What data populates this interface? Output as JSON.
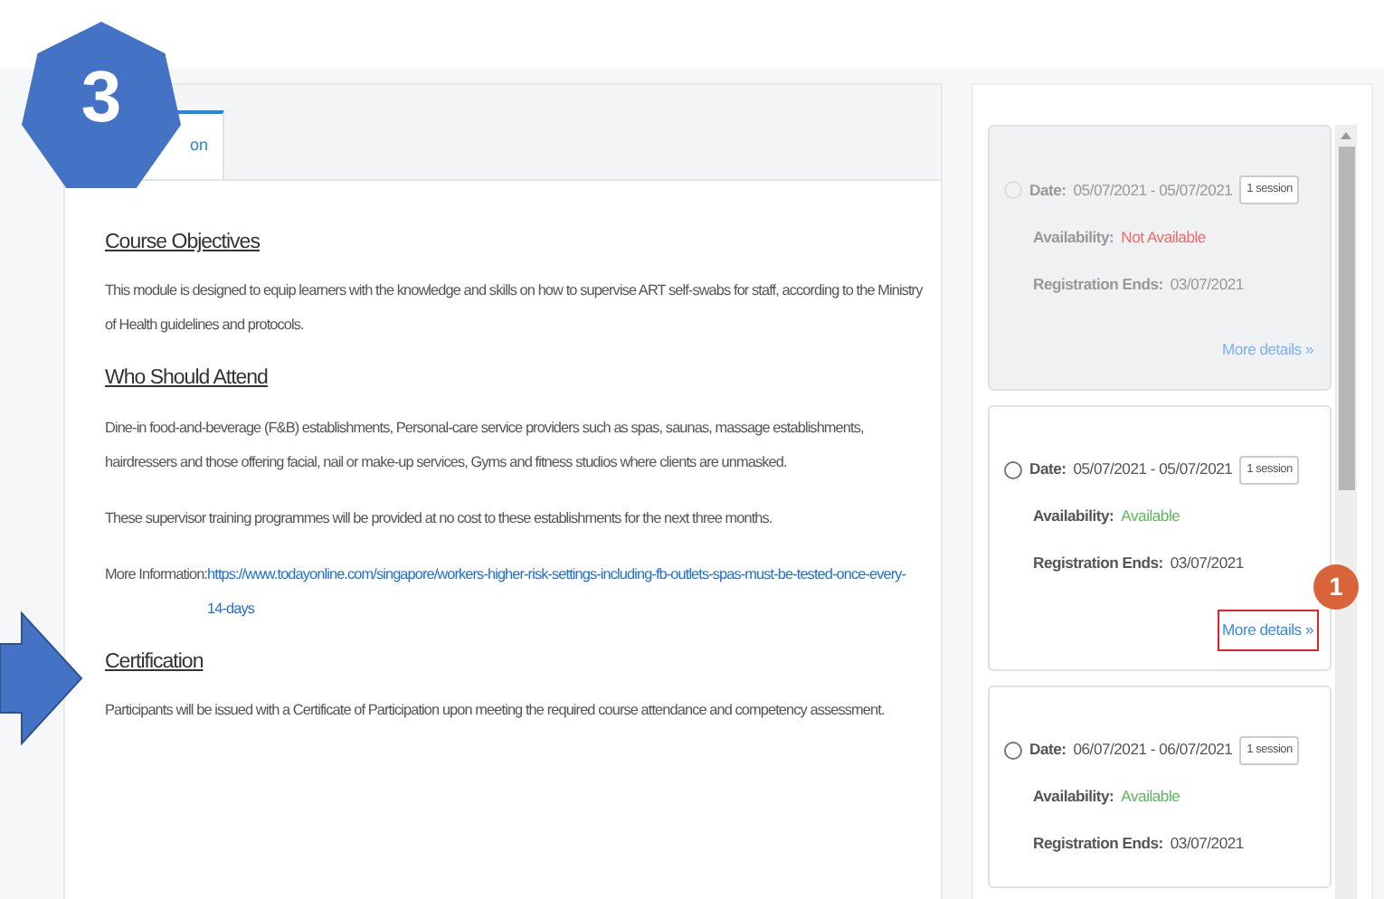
{
  "overlays": [
    {
      "kind": "step",
      "label": "3"
    },
    {
      "kind": "arrow"
    },
    {
      "kind": "dot",
      "label": "1"
    }
  ],
  "tabs": [
    {
      "label": "on",
      "selected": true
    }
  ],
  "sections": [
    {
      "heading": "Course Objectives",
      "paragraphs": [
        {
          "text": "This module is designed to equip learners with the knowledge and skills on how to supervise ART self-swabs for staff, according to the Ministry of Health guidelines and protocols."
        }
      ]
    },
    {
      "heading": "Who Should Attend",
      "paragraphs": [
        {
          "text": "Dine-in food-and-beverage (F&B) establishments, Personal-care service providers such as spas, saunas, massage establishments, hairdressers and those offering facial, nail or make-up services, Gyms and fitness studios where clients are unmasked."
        },
        {
          "text": "These supervisor training programmes will be provided at no cost to these establishments for the next three months."
        },
        {
          "text": "More Information: ",
          "link": "https://www.todayonline.com/singapore/workers-higher-risk-settings-including-fb-outlets-spas-must-be-tested-once-every-14-days"
        }
      ]
    },
    {
      "heading": "Certification",
      "paragraphs": [
        {
          "text": "Participants will be issued with a Certificate of Participation upon meeting the required course attendance and competency assessment."
        }
      ]
    }
  ],
  "sessions": [
    {
      "selected": false,
      "disabled": true,
      "date_label": "Date:",
      "date": "05/07/2021 - 05/07/2021",
      "badge": "1 session",
      "availability_label": "Availability:",
      "availability": "Not Available",
      "available": false,
      "registration_label": "Registration Ends:",
      "registration": "03/07/2021",
      "link": "More details",
      "link_icon": "»",
      "highlighted": false
    },
    {
      "selected": false,
      "disabled": false,
      "date_label": "Date:",
      "date": "05/07/2021 - 05/07/2021",
      "badge": "1 session",
      "availability_label": "Availability:",
      "availability": "Available",
      "available": true,
      "registration_label": "Registration Ends:",
      "registration": "03/07/2021",
      "link": "More details",
      "link_icon": "»",
      "highlighted": true
    },
    {
      "selected": false,
      "disabled": false,
      "date_label": "Date:",
      "date": "06/07/2021 - 06/07/2021",
      "badge": "1 session",
      "availability_label": "Availability:",
      "availability": "Available",
      "available": true,
      "registration_label": "Registration Ends:",
      "registration": "03/07/2021"
    }
  ]
}
